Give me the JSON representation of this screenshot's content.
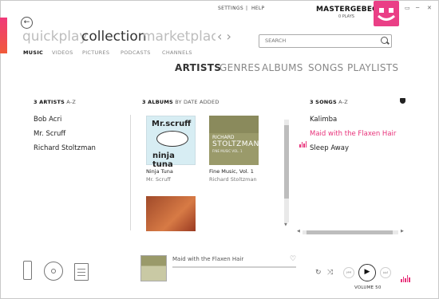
{
  "window": {
    "settings_label": "SETTINGS",
    "separator": "|",
    "help_label": "HELP",
    "username": "MASTERGEBEO",
    "plays": "0 PLAYS",
    "back_icon": "back-arrow-icon",
    "minimize_glyph": "▭",
    "restore_glyph": "─",
    "close_glyph": "✕",
    "accent_color": "#e8327a"
  },
  "pivots": {
    "quickplay": "quickplay",
    "collection": "collection",
    "marketplace": "marketplace",
    "prev_arrow": "‹",
    "next_arrow": "›"
  },
  "subnav": {
    "music": "MUSIC",
    "videos": "VIDEOS",
    "pictures": "PICTURES",
    "podcasts": "PODCASTS",
    "channels": "CHANNELS"
  },
  "search": {
    "placeholder": "SEARCH"
  },
  "categories": {
    "artists": "ARTISTS",
    "genres": "GENRES",
    "albums": "ALBUMS",
    "songs": "SONGS",
    "playlists": "PLAYLISTS"
  },
  "artists_column": {
    "count_label": "3 ARTISTS",
    "sort_label": "A-Z",
    "items": [
      "Bob Acri",
      "Mr. Scruff",
      "Richard Stoltzman"
    ]
  },
  "albums_column": {
    "count_label": "3 ALBUMS",
    "sort_label": "BY DATE ADDED",
    "items": [
      {
        "title": "Ninja Tuna",
        "artist": "Mr. Scruff",
        "cover_text_top": "Mr.scruff",
        "cover_text_bottom": "ninja tuna"
      },
      {
        "title": "Fine Music, Vol. 1",
        "artist": "Richard Stoltzman",
        "cover_text_top": "RICHARD",
        "cover_text_main": "STOLTZMAN",
        "cover_text_small": "FINE MUSIC VOL. 1"
      },
      {
        "title": "",
        "artist": ""
      }
    ]
  },
  "songs_column": {
    "count_label": "3 SONGS",
    "sort_label": "A-Z",
    "items": [
      {
        "title": "Kalimba",
        "playing": false
      },
      {
        "title": "Maid with the Flaxen Hair",
        "playing": true
      },
      {
        "title": "Sleep Away",
        "playing": false
      }
    ]
  },
  "now_playing": {
    "title": "Maid with the Flaxen Hair",
    "heart_glyph": "♡",
    "repeat_glyph": "↻",
    "shuffle_glyph": "⤨",
    "prev_glyph": "⏮",
    "play_glyph": "▶",
    "next_glyph": "⏭",
    "volume_label": "VOLUME 50"
  }
}
